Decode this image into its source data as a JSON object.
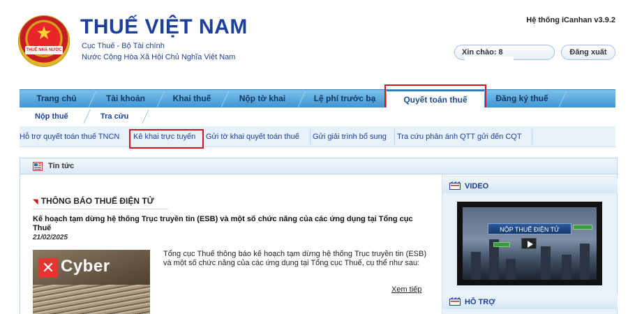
{
  "header": {
    "title": "THUẾ VIỆT NAM",
    "subtitle_line1": "Cục Thuế - Bộ Tài chính",
    "subtitle_line2": "Nước Cộng Hòa Xã Hội Chủ Nghĩa Việt Nam",
    "logo_text": "THUẾ NHÀ NƯỚC",
    "system_version": "Hệ thống iCanhan v3.9.2",
    "greeting_label": "Xin chào: 8",
    "logout_label": "Đăng xuất"
  },
  "main_nav": {
    "items": [
      {
        "label": "Trang chủ"
      },
      {
        "label": "Tài khoản"
      },
      {
        "label": "Khai thuế"
      },
      {
        "label": "Nộp tờ khai"
      },
      {
        "label": "Lệ phí trước bạ"
      },
      {
        "label": "Quyết toán thuế",
        "active": true
      },
      {
        "label": "Đăng ký thuế"
      }
    ]
  },
  "sub_nav": {
    "items": [
      {
        "label": "Nộp thuế"
      },
      {
        "label": "Tra cứu"
      }
    ]
  },
  "third_nav": {
    "items": [
      {
        "label": "Hỗ trợ quyết toán thuế TNCN"
      },
      {
        "label": "Kê khai trực tuyến",
        "highlighted": true
      },
      {
        "label": "Gửi tờ khai quyết toán thuế"
      },
      {
        "label": "Gửi giải trình bổ sung"
      },
      {
        "label": "Tra cứu phản ánh QTT gửi đến CQT"
      }
    ]
  },
  "news_panel": {
    "title": "Tin tức",
    "category": "THÔNG BÁO THUẾ ĐIỆN TỬ",
    "headline": "Kế hoạch tạm dừng hệ thống Trục truyền tin (ESB) và một số chức năng của các ứng dụng tại Tổng cục Thuế",
    "date": "21/02/2025",
    "thumbnail_brand": "Cyber",
    "summary": "Tổng cục Thuế thông báo kế hoạch tạm dừng hệ thống Trục truyền tin (ESB) và một số chức năng của các ứng dụng tại Tổng cục Thuế, cụ thể như sau:",
    "more_label": "Xem tiếp"
  },
  "sidebar": {
    "video_title": "VIDEO",
    "video_banner": "NỘP THUẾ ĐIỆN TỬ",
    "support_title": "HỖ TRỢ"
  },
  "colors": {
    "brand_blue": "#1b3f9a",
    "nav_blue": "#3e95d3",
    "highlight_red": "#d7141c"
  }
}
